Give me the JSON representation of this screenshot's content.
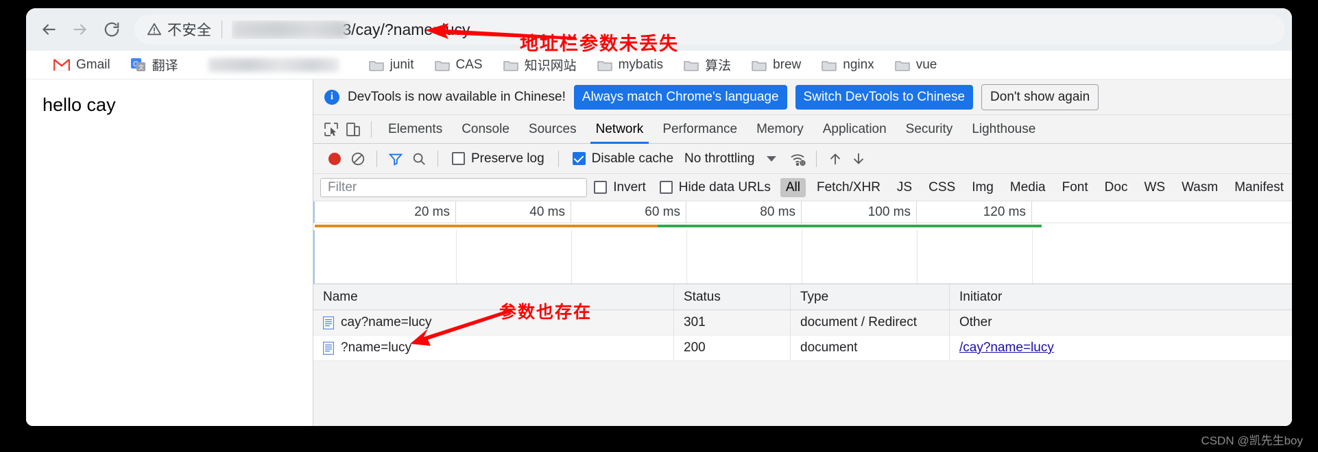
{
  "browser": {
    "nav": {
      "back_icon": "arrow-left-icon",
      "forward_icon": "arrow-right-icon",
      "reload_icon": "reload-icon"
    },
    "omnibox": {
      "security_icon": "warning-triangle-icon",
      "security_label": "不安全",
      "url_visible": "3/cay/?name=lucy",
      "url_redacted": true
    }
  },
  "annotations": [
    {
      "text": "地址栏参数未丢失",
      "color": "#fc0404",
      "arrow": "left-arrow"
    },
    {
      "text": "参数也存在",
      "color": "#fc0404",
      "arrow": "down-left-arrow"
    }
  ],
  "bookmarks": [
    {
      "label": "Gmail",
      "icon": "gmail-icon"
    },
    {
      "label": "翻译",
      "icon": "google-translate-icon"
    },
    {
      "label": "",
      "icon": "redacted-bookmark"
    },
    {
      "label": "junit",
      "icon": "folder-icon"
    },
    {
      "label": "CAS",
      "icon": "folder-icon"
    },
    {
      "label": "知识网站",
      "icon": "folder-icon"
    },
    {
      "label": "mybatis",
      "icon": "folder-icon"
    },
    {
      "label": "算法",
      "icon": "folder-icon"
    },
    {
      "label": "brew",
      "icon": "folder-icon"
    },
    {
      "label": "nginx",
      "icon": "folder-icon"
    },
    {
      "label": "vue",
      "icon": "folder-icon"
    }
  ],
  "page": {
    "body_text": "hello cay"
  },
  "devtools": {
    "notice": {
      "icon": "info-icon",
      "message": "DevTools is now available in Chinese!",
      "primary_button": "Always match Chrome's language",
      "secondary_button": "Switch DevTools to Chinese",
      "dismiss_button": "Don't show again"
    },
    "left_tools": [
      "inspect-element-icon",
      "device-toolbar-icon"
    ],
    "tabs": [
      {
        "label": "Elements",
        "active": false
      },
      {
        "label": "Console",
        "active": false
      },
      {
        "label": "Sources",
        "active": false
      },
      {
        "label": "Network",
        "active": true
      },
      {
        "label": "Performance",
        "active": false
      },
      {
        "label": "Memory",
        "active": false
      },
      {
        "label": "Application",
        "active": false
      },
      {
        "label": "Security",
        "active": false
      },
      {
        "label": "Lighthouse",
        "active": false
      }
    ],
    "network_toolbar": {
      "record_icon": "record-button-icon",
      "clear_icon": "clear-icon",
      "filter_icon": "funnel-icon",
      "search_icon": "search-icon",
      "preserve_log": {
        "label": "Preserve log",
        "checked": false
      },
      "disable_cache": {
        "label": "Disable cache",
        "checked": true
      },
      "throttling": "No throttling",
      "throttle_caret": "chevron-down-icon",
      "wifi_icon": "network-conditions-icon",
      "import_icon": "upload-har-icon",
      "export_icon": "download-har-icon"
    },
    "filter_row": {
      "placeholder": "Filter",
      "invert": {
        "label": "Invert",
        "checked": false
      },
      "hide_data_urls": {
        "label": "Hide data URLs",
        "checked": false
      },
      "types": [
        {
          "label": "All",
          "active": true
        },
        {
          "label": "Fetch/XHR",
          "active": false
        },
        {
          "label": "JS",
          "active": false
        },
        {
          "label": "CSS",
          "active": false
        },
        {
          "label": "Img",
          "active": false
        },
        {
          "label": "Media",
          "active": false
        },
        {
          "label": "Font",
          "active": false
        },
        {
          "label": "Doc",
          "active": false
        },
        {
          "label": "WS",
          "active": false
        },
        {
          "label": "Wasm",
          "active": false
        },
        {
          "label": "Manifest",
          "active": false
        }
      ]
    },
    "timeline": {
      "ticks": [
        "20 ms",
        "40 ms",
        "60 ms",
        "80 ms",
        "100 ms",
        "120 ms"
      ],
      "bars": [
        {
          "color": "#e08c22",
          "start_pct": 0.0,
          "width_pct": 46.5
        },
        {
          "color": "#34a853",
          "start_pct": 46.5,
          "width_pct": 52.0
        }
      ]
    },
    "requests": {
      "columns": [
        "Name",
        "Status",
        "Type",
        "Initiator"
      ],
      "rows": [
        {
          "icon": "document-icon",
          "name": "cay?name=lucy",
          "status": "301",
          "type": "document / Redirect",
          "initiator": "Other",
          "initiator_is_link": false
        },
        {
          "icon": "document-icon",
          "name": "?name=lucy",
          "status": "200",
          "type": "document",
          "initiator": "/cay?name=lucy",
          "initiator_is_link": true
        }
      ]
    }
  },
  "watermark": "CSDN @凯先生boy"
}
